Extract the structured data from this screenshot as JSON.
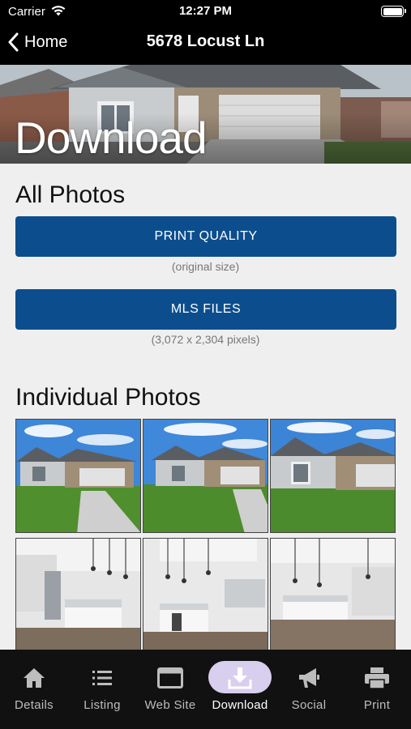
{
  "status_bar": {
    "carrier": "Carrier",
    "time": "12:27 PM"
  },
  "nav": {
    "back_label": "Home",
    "title": "5678 Locust Ln"
  },
  "hero": {
    "title": "Download"
  },
  "all_photos": {
    "heading": "All Photos",
    "print_quality": {
      "label": "PRINT QUALITY",
      "caption": "(original size)"
    },
    "mls_files": {
      "label": "MLS FILES",
      "caption": "(3,072 x 2,304 pixels)"
    }
  },
  "individual_photos": {
    "heading": "Individual Photos",
    "thumbnails": [
      "exterior-front-1",
      "exterior-front-2",
      "exterior-front-3",
      "kitchen-1",
      "kitchen-2",
      "kitchen-3"
    ]
  },
  "tabs": [
    {
      "label": "Details",
      "icon": "home-icon"
    },
    {
      "label": "Listing",
      "icon": "list-icon"
    },
    {
      "label": "Web Site",
      "icon": "browser-icon"
    },
    {
      "label": "Download",
      "icon": "download-icon",
      "active": true
    },
    {
      "label": "Social",
      "icon": "megaphone-icon"
    },
    {
      "label": "Print",
      "icon": "printer-icon"
    }
  ],
  "colors": {
    "accent_button": "#0c4e8d",
    "active_tab_pill": "#d8cfee",
    "tab_bar": "#111111"
  }
}
